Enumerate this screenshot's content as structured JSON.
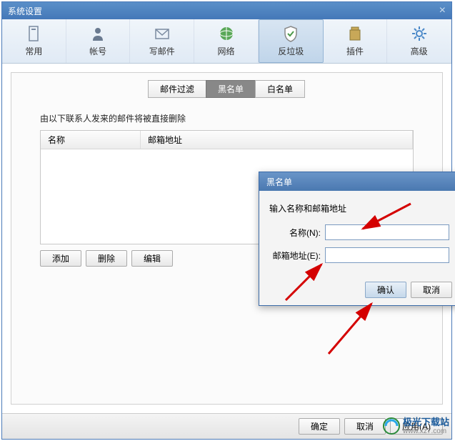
{
  "window": {
    "title": "系统设置"
  },
  "toolbar": {
    "items": [
      {
        "label": "常用",
        "icon": "general"
      },
      {
        "label": "帐号",
        "icon": "account"
      },
      {
        "label": "写邮件",
        "icon": "compose"
      },
      {
        "label": "网络",
        "icon": "network"
      },
      {
        "label": "反垃圾",
        "icon": "antispam"
      },
      {
        "label": "插件",
        "icon": "plugin"
      },
      {
        "label": "高级",
        "icon": "advanced"
      }
    ]
  },
  "sub_tabs": {
    "items": [
      "邮件过滤",
      "黑名单",
      "白名单"
    ],
    "active_index": 1
  },
  "blacklist": {
    "instruction": "由以下联系人发来的邮件将被直接删除",
    "columns": {
      "name": "名称",
      "email": "邮箱地址"
    }
  },
  "actions": {
    "add": "添加",
    "delete": "删除",
    "edit": "编辑"
  },
  "bottom": {
    "ok": "确定",
    "cancel": "取消",
    "apply": "应用(A)"
  },
  "dialog": {
    "title": "黑名单",
    "instruction": "输入名称和邮箱地址",
    "name_label": "名称(N):",
    "email_label": "邮箱地址(E):",
    "name_value": "",
    "email_value": "",
    "ok": "确认",
    "cancel": "取消"
  },
  "watermark": {
    "name": "极光下载站",
    "url": "www.xz7.com"
  }
}
